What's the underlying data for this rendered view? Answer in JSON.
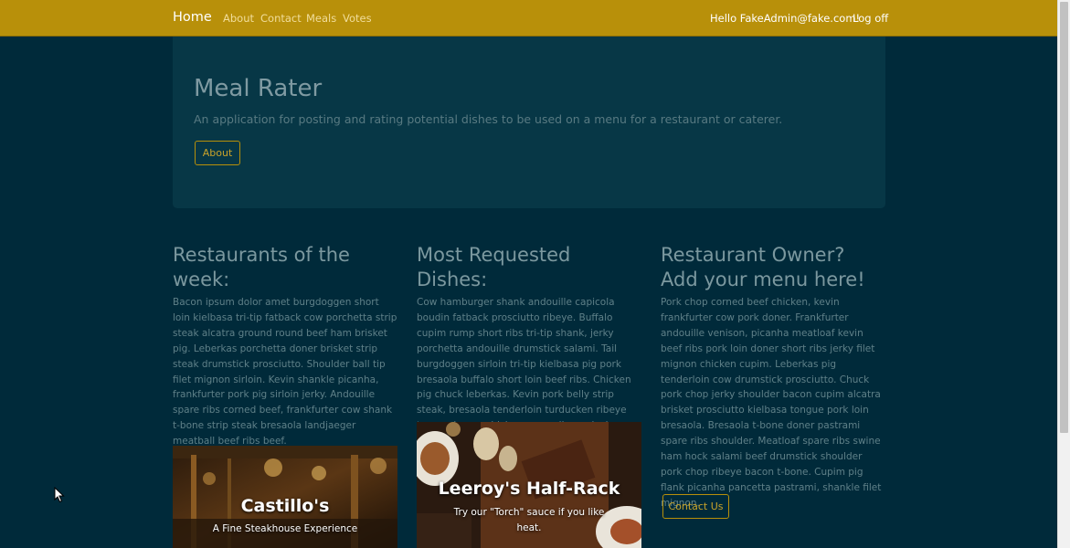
{
  "navbar": {
    "brand": "Home",
    "links": [
      "About",
      "Contact",
      "Meals",
      "Votes"
    ],
    "greeting": "Hello FakeAdmin@fake.com!",
    "logoff": "Log off"
  },
  "jumbotron": {
    "title": "Meal Rater",
    "lead": "An application for posting and rating potential dishes to be used on a menu for a restaurant or caterer.",
    "about_button": "About"
  },
  "columns": [
    {
      "heading": "Restaurants of the week:",
      "body": "Bacon ipsum dolor amet burgdoggen short loin kielbasa tri-tip fatback cow porchetta strip steak alcatra ground round beef ham brisket pig. Leberkas porchetta doner brisket strip steak drumstick prosciutto. Shoulder ball tip filet mignon sirloin. Kevin shankle picanha, frankfurter pork pig sirloin jerky. Andouille spare ribs corned beef, frankfurter cow shank t-bone strip steak bresaola landjaeger meatball beef ribs beef.",
      "card_title": "Castillo's",
      "card_subtitle": "A Fine Steakhouse Experience"
    },
    {
      "heading": "Most Requested Dishes:",
      "body": "Cow hamburger shank andouille capicola boudin fatback prosciutto ribeye. Buffalo cupim rump short ribs tri-tip shank, jerky porchetta andouille drumstick salami. Tail burgdoggen sirloin tri-tip kielbasa pig pork bresaola buffalo short loin beef ribs. Chicken pig chuck leberkas. Kevin pork belly strip steak, bresaola tenderloin turducken ribeye tongue bacon chicken spare ribs pork chop short loin alcatra beef ribs.",
      "card_title": "Leeroy's Half-Rack",
      "card_subtitle": "Try our \"Torch\" sauce if you like heat."
    },
    {
      "heading": "Restaurant Owner? Add your menu here!",
      "body": "Pork chop corned beef chicken, kevin frankfurter cow pork doner. Frankfurter andouille venison, picanha meatloaf kevin beef ribs pork loin doner short ribs jerky filet mignon chicken cupim. Leberkas pig tenderloin cow drumstick prosciutto. Chuck pork chop jerky shoulder bacon cupim alcatra brisket prosciutto kielbasa tongue pork loin bresaola. Bresaola t-bone doner pastrami spare ribs shoulder. Meatloaf spare ribs swine ham hock salami beef drumstick shoulder pork chop ribeye bacon t-bone. Cupim pig flank picanha pancetta pastrami, shankle filet mignon.",
      "contact_button": "Contact Us"
    }
  ],
  "colors": {
    "navbar": "#b8900a",
    "background": "#002a3a",
    "jumbotron": "#073746",
    "accent": "#c9a32a"
  },
  "icons": [
    "mouse-cursor-icon"
  ]
}
